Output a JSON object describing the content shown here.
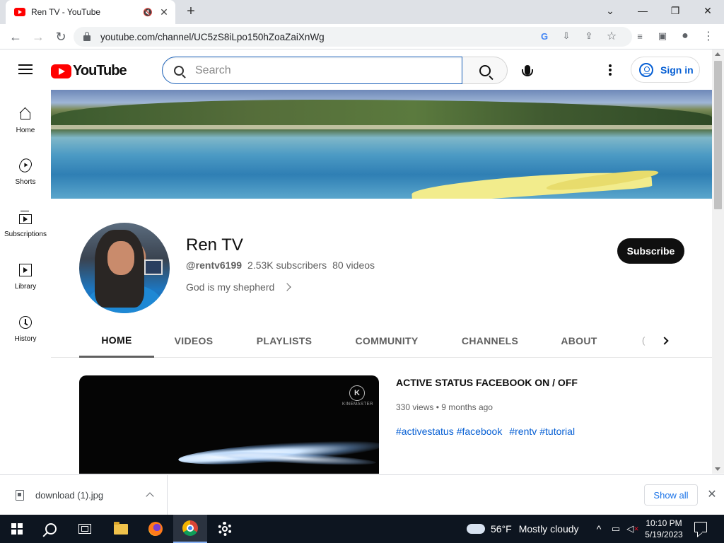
{
  "browser": {
    "tab_title": "Ren TV - YouTube",
    "tab_audio_icon": "🔇",
    "tab_close": "✕",
    "new_tab": "+",
    "url": "youtube.com/channel/UC5zS8iLpo150hZoaZaiXnWg",
    "window_controls": {
      "dropdown": "⌄",
      "minimize": "—",
      "restore": "❐",
      "close": "✕"
    },
    "nav": {
      "back": "←",
      "forward": "→",
      "reload": "↻"
    },
    "omnibox_icons": [
      "google-lens-icon",
      "install-icon",
      "share-icon",
      "star-icon"
    ],
    "toolbar_icons": [
      "reading-list-icon",
      "side-panel-icon",
      "profile-icon",
      "menu-icon"
    ]
  },
  "masthead": {
    "logo_text": "YouTube",
    "search_placeholder": "Search",
    "signin_label": "Sign in"
  },
  "guide": {
    "items": [
      {
        "label": "Home",
        "icon": "home-icon"
      },
      {
        "label": "Shorts",
        "icon": "shorts-icon"
      },
      {
        "label": "Subscriptions",
        "icon": "subscriptions-icon"
      },
      {
        "label": "Library",
        "icon": "library-icon"
      },
      {
        "label": "History",
        "icon": "history-icon"
      }
    ]
  },
  "channel": {
    "name": "Ren TV",
    "handle": "@rentv6199",
    "subscribers": "2.53K subscribers",
    "videos": "80 videos",
    "description": "God is my shepherd",
    "subscribe_label": "Subscribe"
  },
  "tabs": {
    "items": [
      "HOME",
      "VIDEOS",
      "PLAYLISTS",
      "COMMUNITY",
      "CHANNELS",
      "ABOUT"
    ],
    "active": "HOME",
    "overflow": "("
  },
  "featured": {
    "title": "ACTIVE STATUS FACEBOOK ON / OFF",
    "views": "330 views",
    "age": "9 months ago",
    "separator": "•",
    "tags": [
      "#activestatus",
      "#facebook",
      "#rentv",
      "#tutorial"
    ],
    "watermark": "K",
    "watermark_text": "KINEMASTER"
  },
  "downloads": {
    "filename": "download (1).jpg",
    "show_all": "Show all",
    "close": "✕"
  },
  "taskbar": {
    "weather_temp": "56°F",
    "weather_desc": "Mostly cloudy",
    "time": "10:10 PM",
    "date": "5/19/2023",
    "tray_chevron": "^"
  },
  "colors": {
    "youtube_red": "#ff0000",
    "link_blue": "#065fd4",
    "subscribe_bg": "#0f0f0f",
    "taskbar_bg": "#0d1520"
  }
}
